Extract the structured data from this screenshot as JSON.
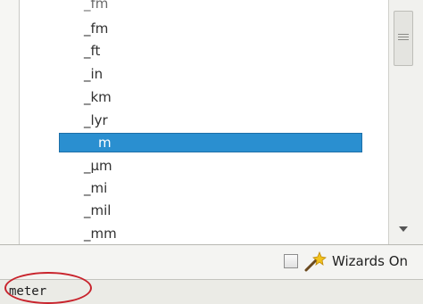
{
  "list": {
    "partial_top_label": "_fm",
    "items": [
      "_fm",
      "_ft",
      "_in",
      "_km",
      "_lyr",
      "m",
      "_µm",
      "_mi",
      "_mil",
      "_mm"
    ],
    "selected_index": 5,
    "selected_label": "m"
  },
  "toolbar": {
    "wizards_label": "Wizards On",
    "wizards_checked": false
  },
  "status": {
    "text": "meter"
  },
  "colors": {
    "selection": "#2a8fd0",
    "highlight_circle": "#c8232c"
  },
  "icons": {
    "wizard": "magic-wand-icon",
    "scroll_grip": "grip-icon",
    "scroll_down": "arrow-down-icon"
  }
}
